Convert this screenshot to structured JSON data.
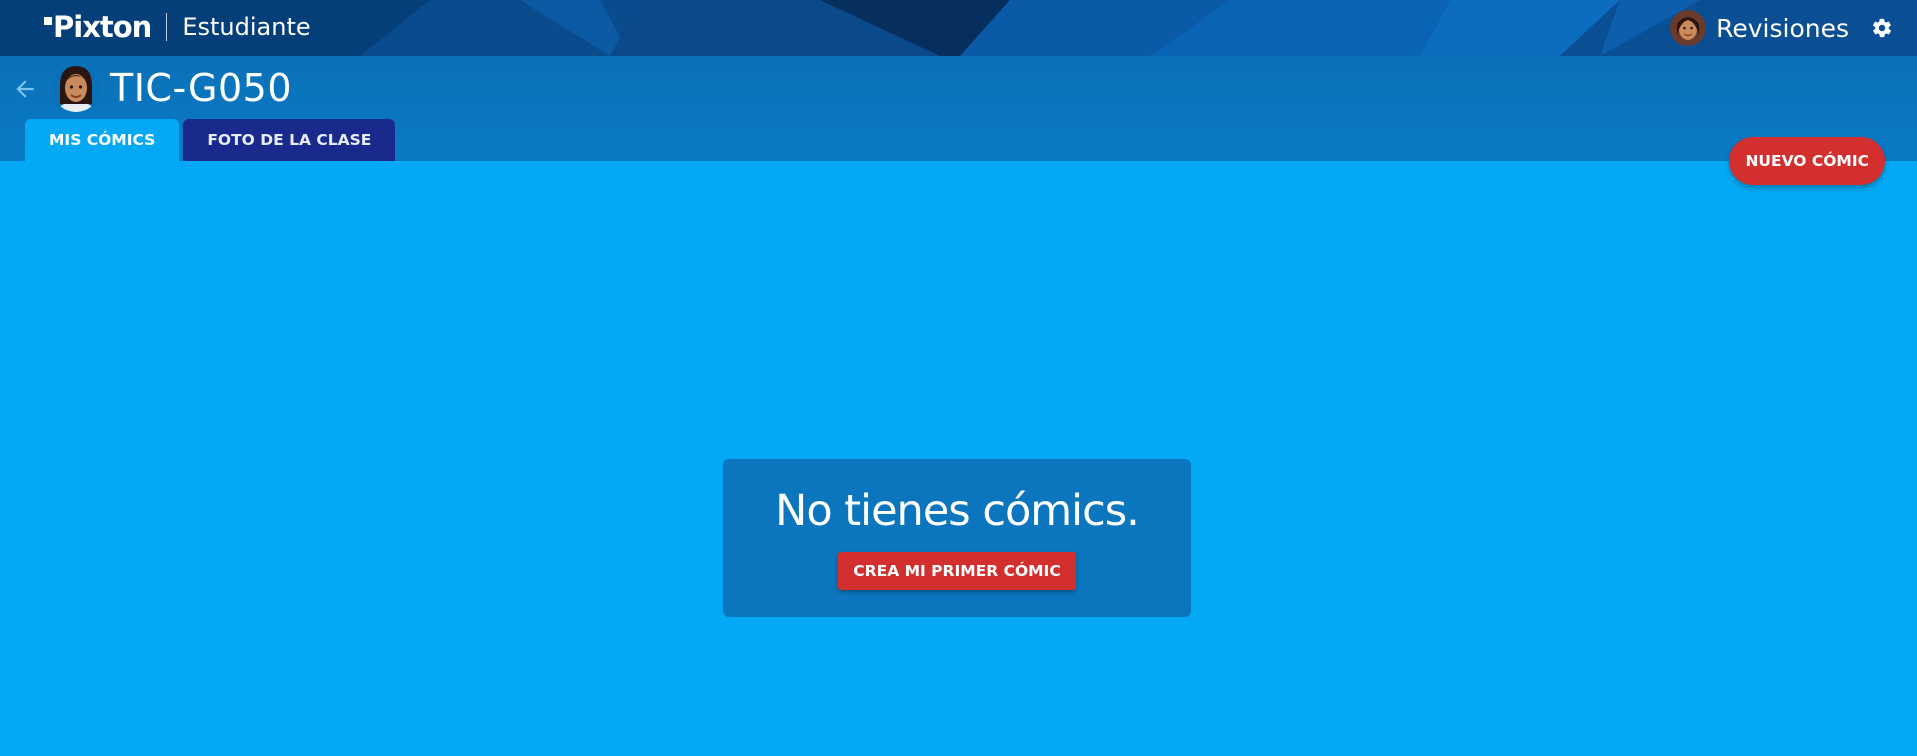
{
  "app": {
    "brand": "Pixton",
    "role": "Estudiante"
  },
  "topbar": {
    "revisiones_label": "Revisiones",
    "settings_icon": "gear-icon",
    "avatar_icon": "student-avatar-icon"
  },
  "class": {
    "title": "TIC-G050",
    "back_icon": "arrow-left-icon",
    "avatar_icon": "student-avatar-icon"
  },
  "tabs": [
    {
      "label": "MIS CÓMICS",
      "active": true
    },
    {
      "label": "FOTO DE LA CLASE",
      "active": false
    }
  ],
  "actions": {
    "new_comic_label": "NUEVO CÓMIC"
  },
  "empty_state": {
    "message": "No tienes cómics.",
    "button_label": "CREA MI PRIMER CÓMIC"
  },
  "colors": {
    "page_background": "#03a9f4",
    "topbar_background": "#053f7a",
    "header_background": "#0a71b8",
    "active_tab": "#03a9f4",
    "inactive_tab": "#1a2a8c",
    "accent_red": "#d32f2f",
    "card_background": "#0b76bd"
  }
}
